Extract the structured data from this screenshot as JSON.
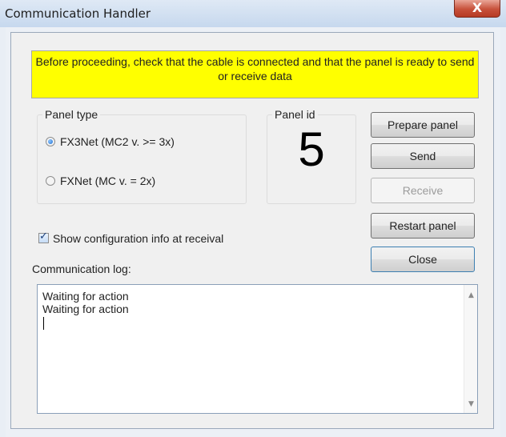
{
  "window": {
    "title": "Communication Handler",
    "close_glyph": "X"
  },
  "warning": "Before proceeding, check that  the cable is connected and that the panel is ready to send or receive data",
  "panel_type": {
    "label": "Panel type",
    "options": [
      {
        "label": "FX3Net (MC2 v. >= 3x)",
        "selected": true
      },
      {
        "label": "FXNet (MC v. = 2x)",
        "selected": false
      }
    ]
  },
  "panel_id": {
    "label": "Panel id",
    "value": "5"
  },
  "buttons": {
    "prepare": "Prepare panel",
    "send": "Send",
    "receive": "Receive",
    "restart": "Restart panel",
    "close": "Close"
  },
  "show_config": {
    "label": "Show configuration info at receival",
    "checked": true
  },
  "log": {
    "label": "Communication log:",
    "lines": "Waiting for action\nWaiting for action"
  }
}
